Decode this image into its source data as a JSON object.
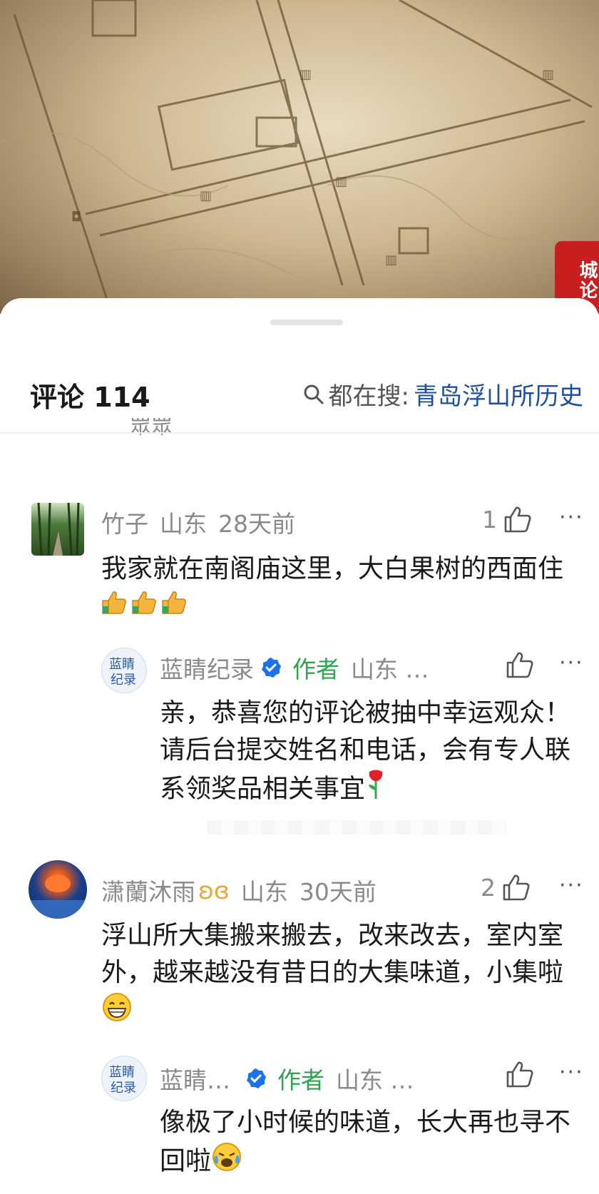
{
  "video": {
    "seal_text": "城论"
  },
  "header": {
    "comments_label": "评论 114",
    "search_label": "都在搜:",
    "search_keyword": "青岛浮山所历史"
  },
  "partial_text": "眾眾",
  "comments": [
    {
      "user": "竹子",
      "location": "山东",
      "time": "28天前",
      "likes": "1",
      "text": "我家就在南阁庙这里，大白果树的西面住",
      "reply": {
        "user": "蓝睛纪录",
        "author_tag": "作者",
        "location": "山东 …",
        "text": "亲，恭喜您的评论被抽中幸运观众！请后台提交姓名和电话，会有专人联系领奖品相关事宜"
      }
    },
    {
      "user": "潇蘭沐雨",
      "location": "山东",
      "time": "30天前",
      "likes": "2",
      "text": "浮山所大集搬来搬去，改来改去，室内室外，越来越没有昔日的大集味道，小集啦",
      "reply": {
        "user": "蓝睛…",
        "author_tag": "作者",
        "location": "山东 …",
        "text": "像极了小时候的味道，长大再也寻不回啦"
      }
    }
  ],
  "icons": [
    "thumb-up-icon",
    "more-icon",
    "search-icon",
    "verified-icon"
  ],
  "colors": {
    "author_green": "#2da44e",
    "keyword_blue": "#1d4f9c",
    "verified_blue": "#1a73e8"
  }
}
